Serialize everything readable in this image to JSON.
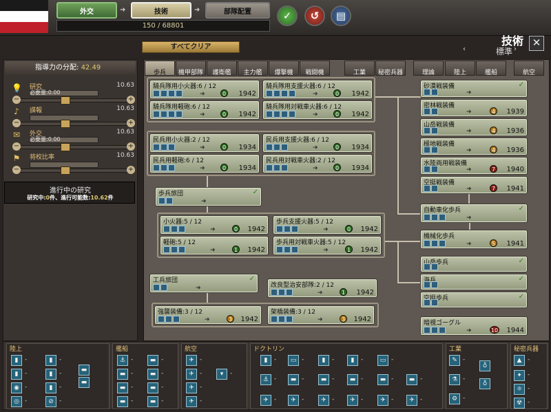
{
  "topbar": {
    "flag": [
      "#1a1a1a",
      "#ffffff",
      "#c0202a"
    ],
    "diplomacy": "外交",
    "technology": "技術",
    "deployment": "部隊配置",
    "progress": "150 / 68801"
  },
  "header": {
    "title": "技術",
    "subtitle": "標準",
    "clear_all": "すべてクリア"
  },
  "leftpanel": {
    "title": "指導力の分配:",
    "title_value": "42.49",
    "rows": [
      {
        "icon": "lightbulb-icon",
        "name": "研究",
        "sub": "必要量:0.00",
        "value": "10.63"
      },
      {
        "icon": "spy-icon",
        "name": "諜報",
        "sub": "",
        "value": "10.63"
      },
      {
        "icon": "envelope-icon",
        "name": "外交",
        "sub": "必要量:0.00",
        "value": "10.63"
      },
      {
        "icon": "flag-icon",
        "name": "将校比率",
        "sub": "",
        "value": "10.63"
      }
    ],
    "research_title": "進行中の研究",
    "research_status_a": "研究中:",
    "research_count": "0",
    "research_status_b": "件、進行可能数:",
    "research_avail": "10.62",
    "research_status_c": "件"
  },
  "tabs": [
    "歩兵",
    "機甲部隊",
    "護衛艦",
    "主力艦",
    "爆撃機",
    "戦闘機",
    "工業",
    "秘密兵器",
    "理論",
    "陸上",
    "艦船",
    "航空"
  ],
  "nodes": {
    "n1": {
      "name": "騎兵隊用小火器:6 / 12",
      "badge": "0",
      "year": "1942"
    },
    "n2": {
      "name": "騎兵隊用支援火器:6 / 12",
      "badge": "0",
      "year": "1942"
    },
    "n3": {
      "name": "騎兵隊用軽砲:6 / 12",
      "badge": "0",
      "year": "1942"
    },
    "n4": {
      "name": "騎兵隊用対戦車火器:6 / 12",
      "badge": "0",
      "year": "1942"
    },
    "n5": {
      "name": "民兵用小火器:2 / 12",
      "badge": "0",
      "year": "1934"
    },
    "n6": {
      "name": "民兵用支援火器:6 / 12",
      "badge": "0",
      "year": "1934"
    },
    "n7": {
      "name": "民兵用軽砲:6 / 12",
      "badge": "0",
      "year": "1934"
    },
    "n8": {
      "name": "民兵用対戦車火器:2 / 12",
      "badge": "0",
      "year": "1934"
    },
    "n9": {
      "name": "歩兵旅団"
    },
    "n10": {
      "name": "小火器:5 / 12",
      "badge": "0",
      "year": "1942"
    },
    "n11": {
      "name": "歩兵支援火器:5 / 12",
      "badge": "0",
      "year": "1942"
    },
    "n12": {
      "name": "軽砲:5 / 12",
      "badge": "1",
      "year": "1942"
    },
    "n13": {
      "name": "歩兵用対戦車火器:5 / 12",
      "badge": "1",
      "year": "1942"
    },
    "n14": {
      "name": "工兵旅団"
    },
    "n15": {
      "name": "改良型治安部隊:2 / 12",
      "badge": "1",
      "year": "1942"
    },
    "n16": {
      "name": "強襲装備:3 / 12",
      "badge": "3",
      "year": "1942"
    },
    "n17": {
      "name": "架橋装備:3 / 12",
      "badge": "3",
      "year": "1942"
    },
    "r1": {
      "name": "砂漠戦装備"
    },
    "r2": {
      "name": "密林戦装備",
      "badge": "4",
      "year": "1939"
    },
    "r3": {
      "name": "山岳戦装備",
      "badge": "4",
      "year": "1936"
    },
    "r4": {
      "name": "極地戦装備",
      "badge": "4",
      "year": "1936"
    },
    "r5": {
      "name": "水陸両用戦装備",
      "badge": "7",
      "year": "1940"
    },
    "r6": {
      "name": "空挺戦装備",
      "badge": "7",
      "year": "1941"
    },
    "r7": {
      "name": "自動車化歩兵"
    },
    "r8": {
      "name": "機械化歩兵",
      "badge": "5",
      "year": "1941"
    },
    "r9": {
      "name": "山岳歩兵"
    },
    "r10": {
      "name": "海兵"
    },
    "r11": {
      "name": "空挺歩兵"
    },
    "r12": {
      "name": "暗視ゴーグル",
      "badge": "10",
      "year": "1944"
    }
  },
  "bottom": {
    "land": "陸上",
    "naval": "艦船",
    "air": "航空",
    "doctrine": "ドクトリン",
    "industry": "工業",
    "secret": "秘密兵器",
    "dash": "-"
  }
}
